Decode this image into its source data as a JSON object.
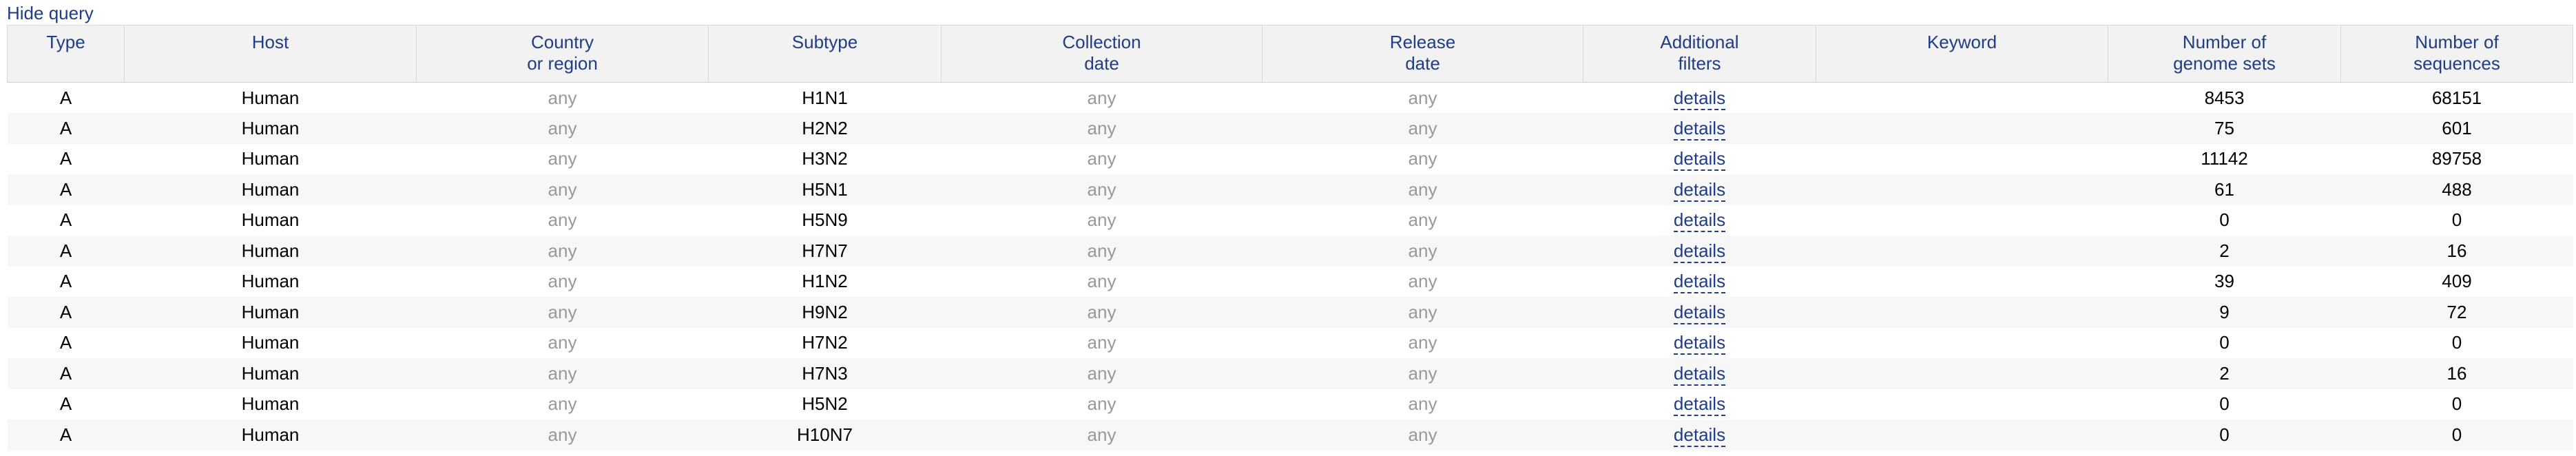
{
  "header": {
    "hide_query_label": "Hide query"
  },
  "table": {
    "columns": [
      {
        "key": "type",
        "line1": "Type",
        "line2": ""
      },
      {
        "key": "host",
        "line1": "Host",
        "line2": ""
      },
      {
        "key": "country",
        "line1": "Country",
        "line2": "or region"
      },
      {
        "key": "subtype",
        "line1": "Subtype",
        "line2": ""
      },
      {
        "key": "collection",
        "line1": "Collection",
        "line2": "date"
      },
      {
        "key": "release",
        "line1": "Release",
        "line2": "date"
      },
      {
        "key": "filters",
        "line1": "Additional",
        "line2": "filters"
      },
      {
        "key": "keyword",
        "line1": "Keyword",
        "line2": ""
      },
      {
        "key": "genome_sets",
        "line1": "Number of",
        "line2": "genome sets"
      },
      {
        "key": "sequences",
        "line1": "Number of",
        "line2": "sequences"
      }
    ],
    "rows": [
      {
        "type": "A",
        "host": "Human",
        "country": "any",
        "subtype": "H1N1",
        "collection": "any",
        "release": "any",
        "filters": "details",
        "keyword": "",
        "genome_sets": "8453",
        "sequences": "68151"
      },
      {
        "type": "A",
        "host": "Human",
        "country": "any",
        "subtype": "H2N2",
        "collection": "any",
        "release": "any",
        "filters": "details",
        "keyword": "",
        "genome_sets": "75",
        "sequences": "601"
      },
      {
        "type": "A",
        "host": "Human",
        "country": "any",
        "subtype": "H3N2",
        "collection": "any",
        "release": "any",
        "filters": "details",
        "keyword": "",
        "genome_sets": "11142",
        "sequences": "89758"
      },
      {
        "type": "A",
        "host": "Human",
        "country": "any",
        "subtype": "H5N1",
        "collection": "any",
        "release": "any",
        "filters": "details",
        "keyword": "",
        "genome_sets": "61",
        "sequences": "488"
      },
      {
        "type": "A",
        "host": "Human",
        "country": "any",
        "subtype": "H5N9",
        "collection": "any",
        "release": "any",
        "filters": "details",
        "keyword": "",
        "genome_sets": "0",
        "sequences": "0"
      },
      {
        "type": "A",
        "host": "Human",
        "country": "any",
        "subtype": "H7N7",
        "collection": "any",
        "release": "any",
        "filters": "details",
        "keyword": "",
        "genome_sets": "2",
        "sequences": "16"
      },
      {
        "type": "A",
        "host": "Human",
        "country": "any",
        "subtype": "H1N2",
        "collection": "any",
        "release": "any",
        "filters": "details",
        "keyword": "",
        "genome_sets": "39",
        "sequences": "409"
      },
      {
        "type": "A",
        "host": "Human",
        "country": "any",
        "subtype": "H9N2",
        "collection": "any",
        "release": "any",
        "filters": "details",
        "keyword": "",
        "genome_sets": "9",
        "sequences": "72"
      },
      {
        "type": "A",
        "host": "Human",
        "country": "any",
        "subtype": "H7N2",
        "collection": "any",
        "release": "any",
        "filters": "details",
        "keyword": "",
        "genome_sets": "0",
        "sequences": "0"
      },
      {
        "type": "A",
        "host": "Human",
        "country": "any",
        "subtype": "H7N3",
        "collection": "any",
        "release": "any",
        "filters": "details",
        "keyword": "",
        "genome_sets": "2",
        "sequences": "16"
      },
      {
        "type": "A",
        "host": "Human",
        "country": "any",
        "subtype": "H5N2",
        "collection": "any",
        "release": "any",
        "filters": "details",
        "keyword": "",
        "genome_sets": "0",
        "sequences": "0"
      },
      {
        "type": "A",
        "host": "Human",
        "country": "any",
        "subtype": "H10N7",
        "collection": "any",
        "release": "any",
        "filters": "details",
        "keyword": "",
        "genome_sets": "0",
        "sequences": "0"
      }
    ]
  },
  "colors": {
    "link": "#1f3c88",
    "muted_any": "#999999",
    "header_bg": "#f2f2f2",
    "row_alt_bg": "#f7f7f7"
  }
}
